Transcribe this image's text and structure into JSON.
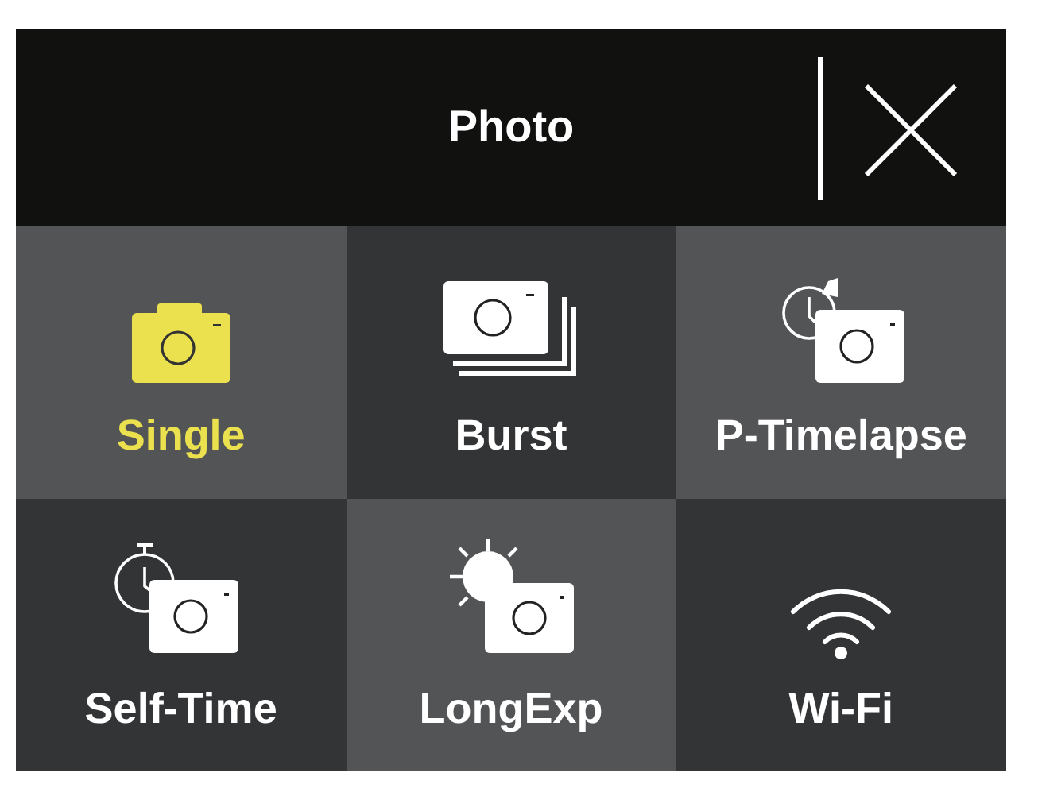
{
  "header": {
    "title": "Photo"
  },
  "modes": [
    {
      "kind": "single",
      "label": "Single",
      "selected": true
    },
    {
      "kind": "burst",
      "label": "Burst",
      "selected": false
    },
    {
      "kind": "timelapse",
      "label": "P-Timelapse",
      "selected": false
    },
    {
      "kind": "selftimer",
      "label": "Self-Time",
      "selected": false
    },
    {
      "kind": "longexp",
      "label": "LongExp",
      "selected": false
    },
    {
      "kind": "wifi",
      "label": "Wi-Fi",
      "selected": false
    }
  ]
}
